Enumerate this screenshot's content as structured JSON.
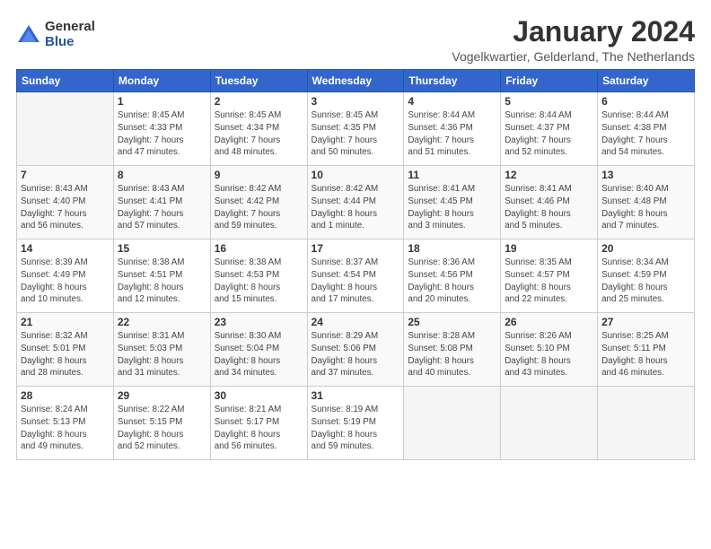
{
  "logo": {
    "general": "General",
    "blue": "Blue"
  },
  "title": "January 2024",
  "subtitle": "Vogelkwartier, Gelderland, The Netherlands",
  "days_of_week": [
    "Sunday",
    "Monday",
    "Tuesday",
    "Wednesday",
    "Thursday",
    "Friday",
    "Saturday"
  ],
  "weeks": [
    [
      {
        "day": "",
        "info": ""
      },
      {
        "day": "1",
        "info": "Sunrise: 8:45 AM\nSunset: 4:33 PM\nDaylight: 7 hours\nand 47 minutes."
      },
      {
        "day": "2",
        "info": "Sunrise: 8:45 AM\nSunset: 4:34 PM\nDaylight: 7 hours\nand 48 minutes."
      },
      {
        "day": "3",
        "info": "Sunrise: 8:45 AM\nSunset: 4:35 PM\nDaylight: 7 hours\nand 50 minutes."
      },
      {
        "day": "4",
        "info": "Sunrise: 8:44 AM\nSunset: 4:36 PM\nDaylight: 7 hours\nand 51 minutes."
      },
      {
        "day": "5",
        "info": "Sunrise: 8:44 AM\nSunset: 4:37 PM\nDaylight: 7 hours\nand 52 minutes."
      },
      {
        "day": "6",
        "info": "Sunrise: 8:44 AM\nSunset: 4:38 PM\nDaylight: 7 hours\nand 54 minutes."
      }
    ],
    [
      {
        "day": "7",
        "info": "Sunrise: 8:43 AM\nSunset: 4:40 PM\nDaylight: 7 hours\nand 56 minutes."
      },
      {
        "day": "8",
        "info": "Sunrise: 8:43 AM\nSunset: 4:41 PM\nDaylight: 7 hours\nand 57 minutes."
      },
      {
        "day": "9",
        "info": "Sunrise: 8:42 AM\nSunset: 4:42 PM\nDaylight: 7 hours\nand 59 minutes."
      },
      {
        "day": "10",
        "info": "Sunrise: 8:42 AM\nSunset: 4:44 PM\nDaylight: 8 hours\nand 1 minute."
      },
      {
        "day": "11",
        "info": "Sunrise: 8:41 AM\nSunset: 4:45 PM\nDaylight: 8 hours\nand 3 minutes."
      },
      {
        "day": "12",
        "info": "Sunrise: 8:41 AM\nSunset: 4:46 PM\nDaylight: 8 hours\nand 5 minutes."
      },
      {
        "day": "13",
        "info": "Sunrise: 8:40 AM\nSunset: 4:48 PM\nDaylight: 8 hours\nand 7 minutes."
      }
    ],
    [
      {
        "day": "14",
        "info": "Sunrise: 8:39 AM\nSunset: 4:49 PM\nDaylight: 8 hours\nand 10 minutes."
      },
      {
        "day": "15",
        "info": "Sunrise: 8:38 AM\nSunset: 4:51 PM\nDaylight: 8 hours\nand 12 minutes."
      },
      {
        "day": "16",
        "info": "Sunrise: 8:38 AM\nSunset: 4:53 PM\nDaylight: 8 hours\nand 15 minutes."
      },
      {
        "day": "17",
        "info": "Sunrise: 8:37 AM\nSunset: 4:54 PM\nDaylight: 8 hours\nand 17 minutes."
      },
      {
        "day": "18",
        "info": "Sunrise: 8:36 AM\nSunset: 4:56 PM\nDaylight: 8 hours\nand 20 minutes."
      },
      {
        "day": "19",
        "info": "Sunrise: 8:35 AM\nSunset: 4:57 PM\nDaylight: 8 hours\nand 22 minutes."
      },
      {
        "day": "20",
        "info": "Sunrise: 8:34 AM\nSunset: 4:59 PM\nDaylight: 8 hours\nand 25 minutes."
      }
    ],
    [
      {
        "day": "21",
        "info": "Sunrise: 8:32 AM\nSunset: 5:01 PM\nDaylight: 8 hours\nand 28 minutes."
      },
      {
        "day": "22",
        "info": "Sunrise: 8:31 AM\nSunset: 5:03 PM\nDaylight: 8 hours\nand 31 minutes."
      },
      {
        "day": "23",
        "info": "Sunrise: 8:30 AM\nSunset: 5:04 PM\nDaylight: 8 hours\nand 34 minutes."
      },
      {
        "day": "24",
        "info": "Sunrise: 8:29 AM\nSunset: 5:06 PM\nDaylight: 8 hours\nand 37 minutes."
      },
      {
        "day": "25",
        "info": "Sunrise: 8:28 AM\nSunset: 5:08 PM\nDaylight: 8 hours\nand 40 minutes."
      },
      {
        "day": "26",
        "info": "Sunrise: 8:26 AM\nSunset: 5:10 PM\nDaylight: 8 hours\nand 43 minutes."
      },
      {
        "day": "27",
        "info": "Sunrise: 8:25 AM\nSunset: 5:11 PM\nDaylight: 8 hours\nand 46 minutes."
      }
    ],
    [
      {
        "day": "28",
        "info": "Sunrise: 8:24 AM\nSunset: 5:13 PM\nDaylight: 8 hours\nand 49 minutes."
      },
      {
        "day": "29",
        "info": "Sunrise: 8:22 AM\nSunset: 5:15 PM\nDaylight: 8 hours\nand 52 minutes."
      },
      {
        "day": "30",
        "info": "Sunrise: 8:21 AM\nSunset: 5:17 PM\nDaylight: 8 hours\nand 56 minutes."
      },
      {
        "day": "31",
        "info": "Sunrise: 8:19 AM\nSunset: 5:19 PM\nDaylight: 8 hours\nand 59 minutes."
      },
      {
        "day": "",
        "info": ""
      },
      {
        "day": "",
        "info": ""
      },
      {
        "day": "",
        "info": ""
      }
    ]
  ]
}
